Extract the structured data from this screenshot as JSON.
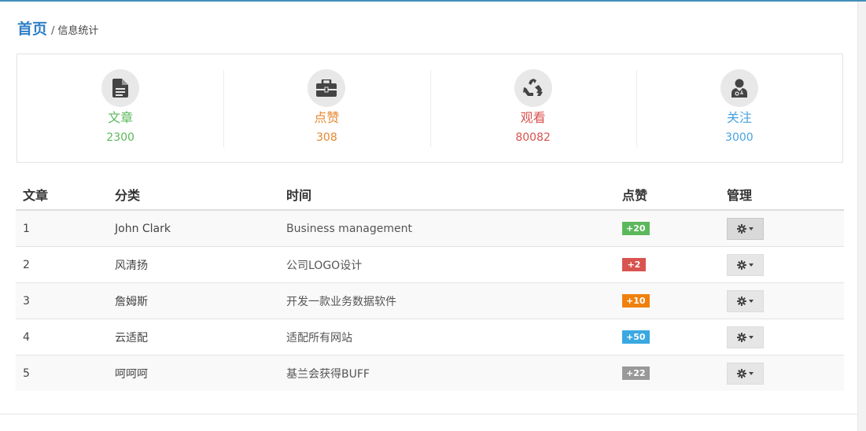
{
  "breadcrumb": {
    "home": "首页",
    "separator": "/",
    "current": "信息统计"
  },
  "stats": [
    {
      "label": "文章",
      "value": "2300",
      "icon": "file-text-icon",
      "color": "#5cb85c"
    },
    {
      "label": "点赞",
      "value": "308",
      "icon": "briefcase-icon",
      "color": "#e6872f"
    },
    {
      "label": "观看",
      "value": "80082",
      "icon": "recycle-icon",
      "color": "#d9534f"
    },
    {
      "label": "关注",
      "value": "3000",
      "icon": "user-md-icon",
      "color": "#4aa3df"
    }
  ],
  "table": {
    "headers": [
      "文章",
      "分类",
      "时间",
      "点赞",
      "管理"
    ],
    "rows": [
      {
        "num": "1",
        "category": "John Clark",
        "title": "Business management",
        "likes": "+20",
        "badge_color": "#5cb85c"
      },
      {
        "num": "2",
        "category": "风清扬",
        "title": "公司LOGO设计",
        "likes": "+2",
        "badge_color": "#d9534f"
      },
      {
        "num": "3",
        "category": "詹姆斯",
        "title": "开发一款业务数据软件",
        "likes": "+10",
        "badge_color": "#f0800d"
      },
      {
        "num": "4",
        "category": "云适配",
        "title": "适配所有网站",
        "likes": "+50",
        "badge_color": "#3aa8e2"
      },
      {
        "num": "5",
        "category": "呵呵呵",
        "title": "基兰会获得BUFF",
        "likes": "+22",
        "badge_color": "#999999"
      }
    ],
    "action_icon": "gear-icon"
  }
}
